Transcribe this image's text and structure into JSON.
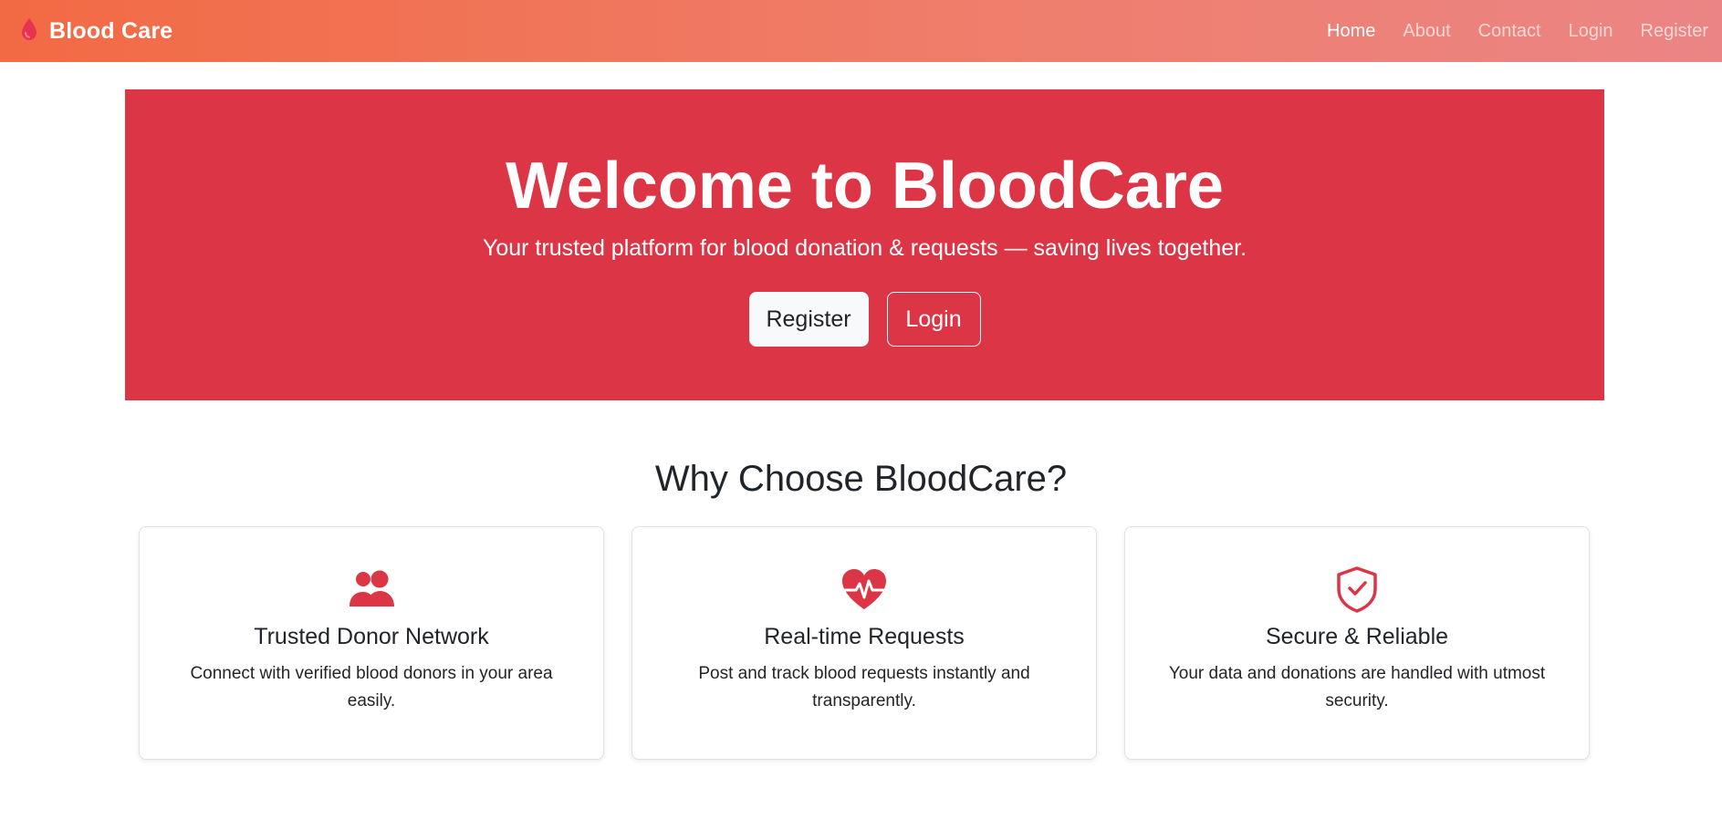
{
  "colors": {
    "primary": "#dc3545",
    "navbar_start": "#f26a43",
    "navbar_end": "#eb8585",
    "text_dark": "#212529",
    "button_light": "#f8f9fa"
  },
  "navbar": {
    "brand_icon": "blood-drop-icon",
    "brand": "Blood Care",
    "links": [
      {
        "label": "Home",
        "active": true
      },
      {
        "label": "About",
        "active": false
      },
      {
        "label": "Contact",
        "active": false
      },
      {
        "label": "Login",
        "active": false
      },
      {
        "label": "Register",
        "active": false
      }
    ]
  },
  "hero": {
    "title": "Welcome to BloodCare",
    "subtitle": "Your trusted platform for blood donation & requests — saving lives together.",
    "register_label": "Register",
    "login_label": "Login"
  },
  "features": {
    "title": "Why Choose BloodCare?",
    "cards": [
      {
        "icon": "people-icon",
        "title": "Trusted Donor Network",
        "text": "Connect with verified blood donors in your area easily."
      },
      {
        "icon": "heart-pulse-icon",
        "title": "Real-time Requests",
        "text": "Post and track blood requests instantly and transparently."
      },
      {
        "icon": "shield-check-icon",
        "title": "Secure & Reliable",
        "text": "Your data and donations are handled with utmost security."
      }
    ]
  }
}
